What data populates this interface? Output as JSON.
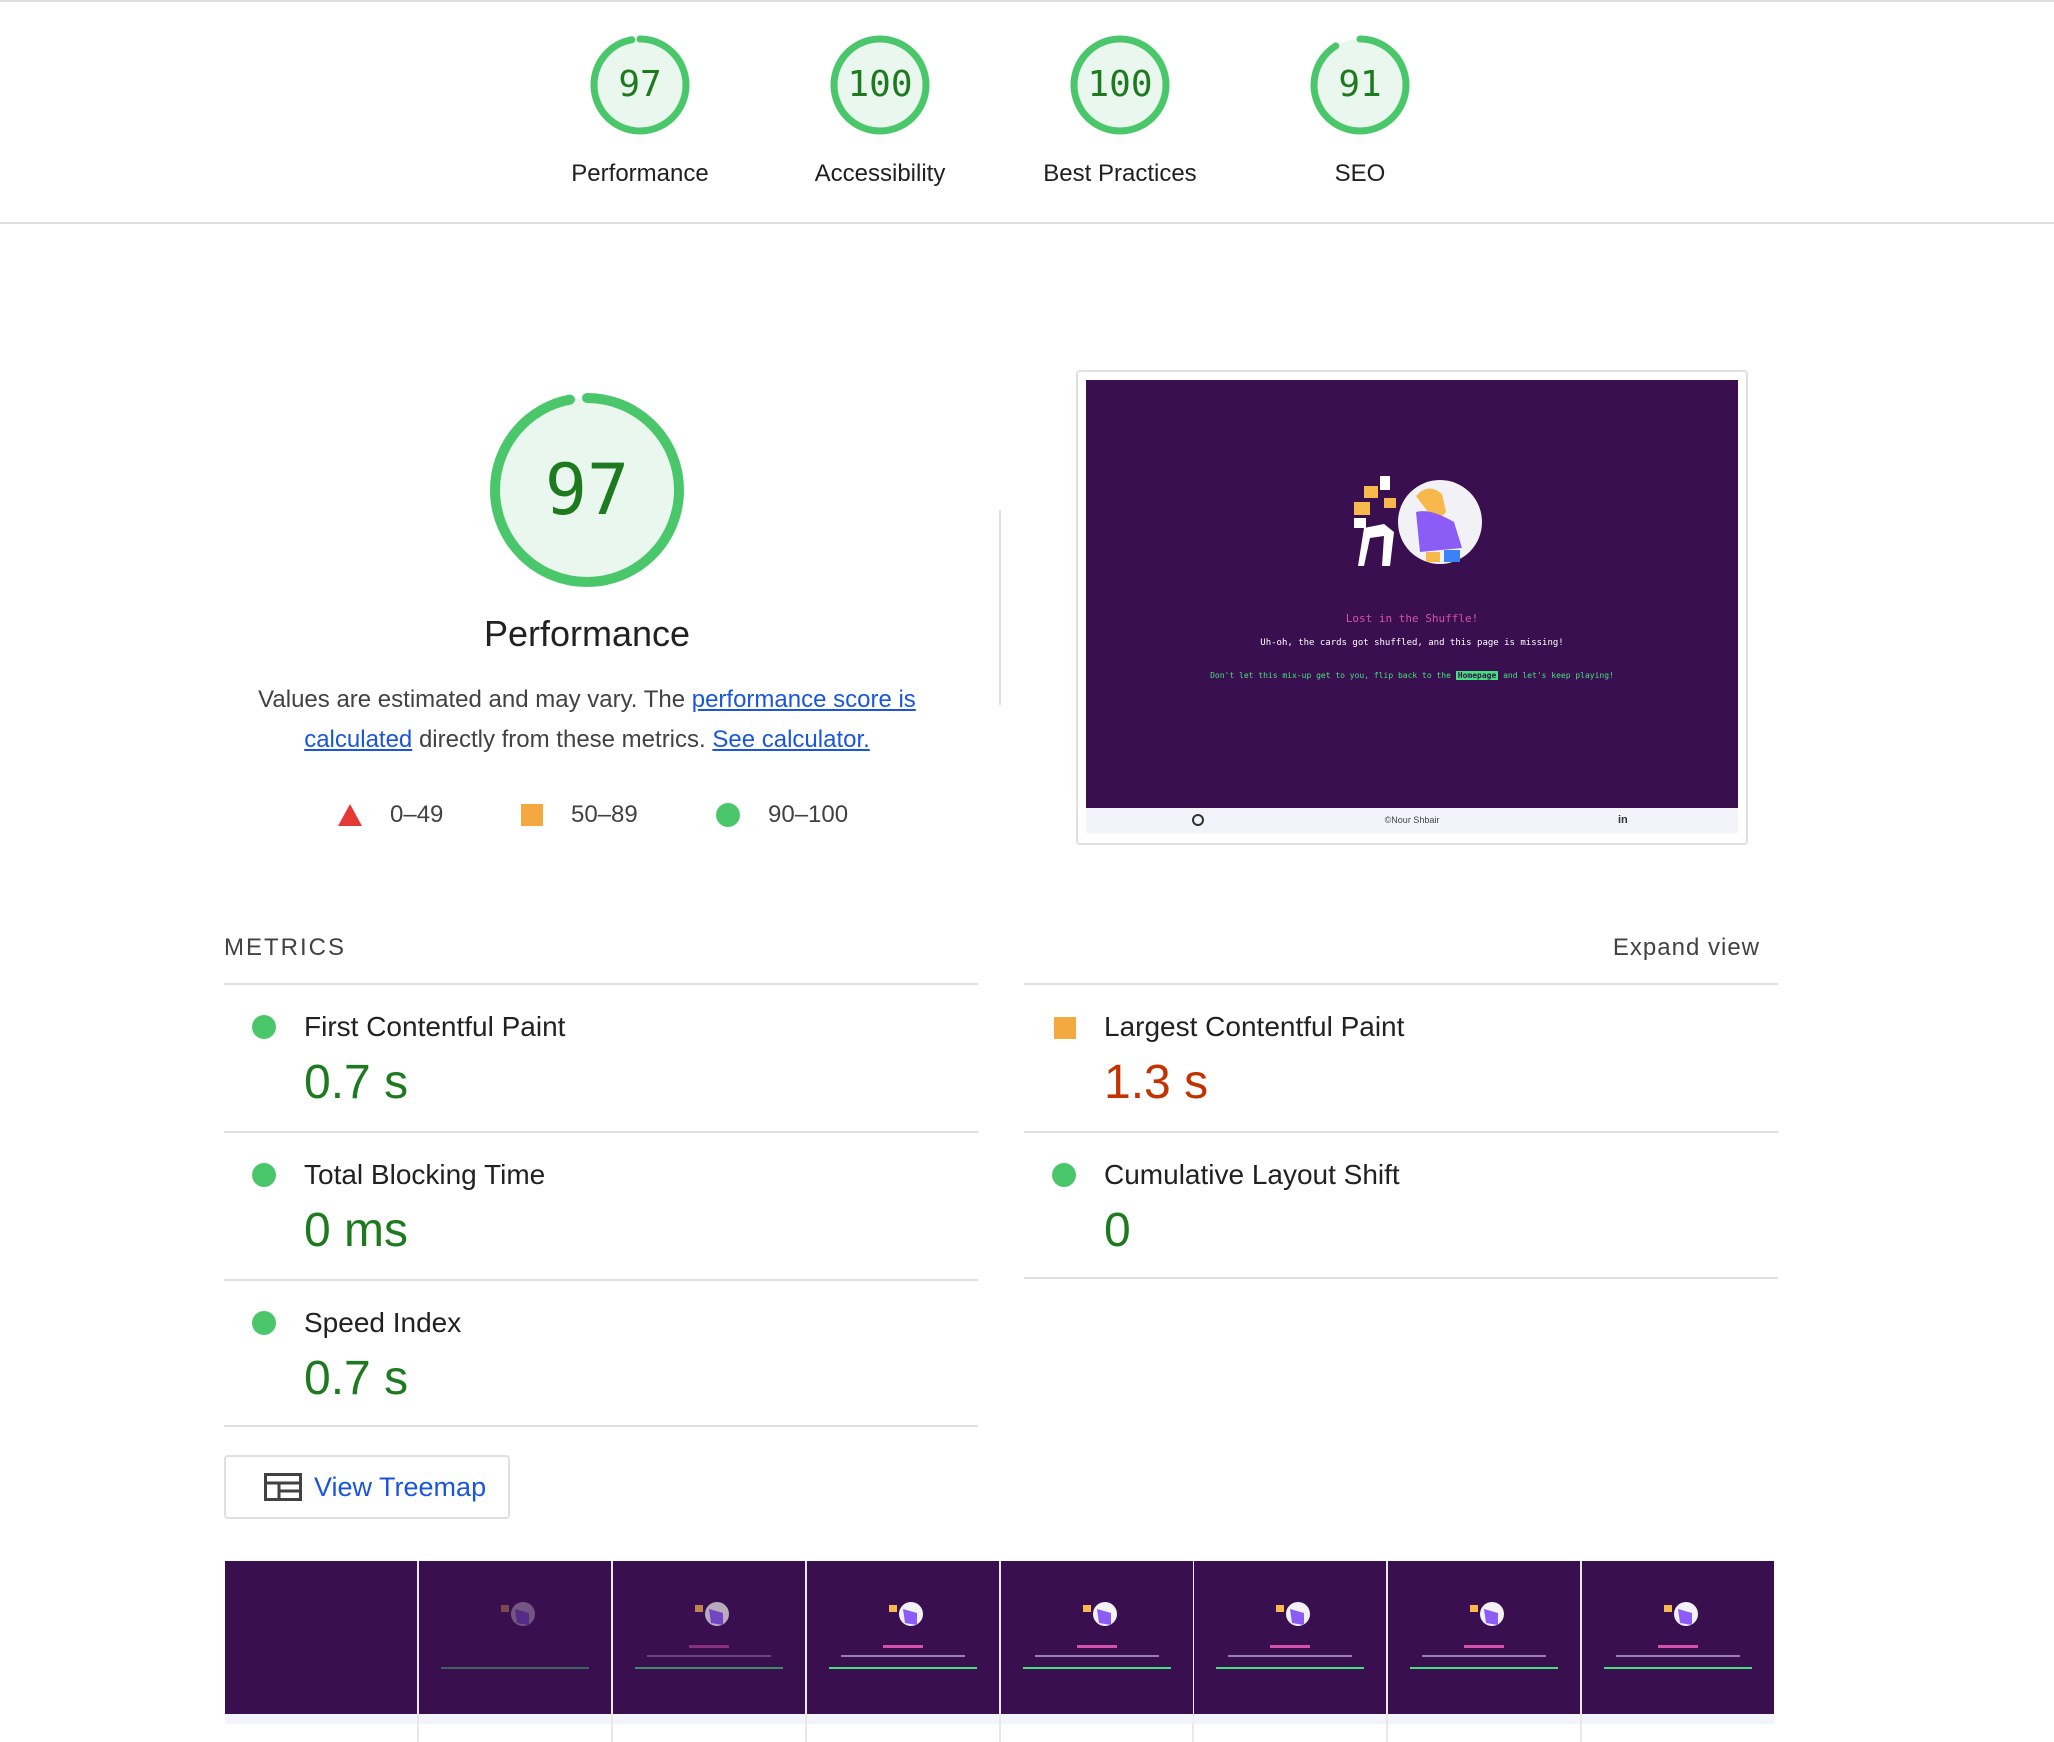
{
  "scores": [
    {
      "value": "97",
      "label": "Performance",
      "fraction": 0.97
    },
    {
      "value": "100",
      "label": "Accessibility",
      "fraction": 1.0
    },
    {
      "value": "100",
      "label": "Best Practices",
      "fraction": 1.0
    },
    {
      "value": "91",
      "label": "SEO",
      "fraction": 0.91
    }
  ],
  "hero": {
    "value": "97",
    "fraction": 0.97,
    "title": "Performance",
    "desc_prefix": "Values are estimated and may vary. The ",
    "desc_link1": "performance score is calculated",
    "desc_middle": " directly from these metrics. ",
    "desc_link2": "See calculator."
  },
  "legend": [
    {
      "shape": "triangle",
      "range": "0–49",
      "color": "#e53935"
    },
    {
      "shape": "square",
      "range": "50–89",
      "color": "#f4a940"
    },
    {
      "shape": "circle",
      "range": "90–100",
      "color": "#4ac76b"
    }
  ],
  "preview": {
    "title": "Lost in the Shuffle!",
    "subtitle": "Uh-oh, the cards got shuffled, and this page is missing!",
    "line_prefix": "Don't let this mix-up get to you, flip back to the ",
    "line_link": "Homepage",
    "line_suffix": " and let's keep playing!",
    "footer_center": "©Nour Shbair",
    "footer_right": "in",
    "footer_left_icon": "github-icon",
    "background_color": "#3a0f4f"
  },
  "metrics": {
    "heading": "METRICS",
    "expand_label": "Expand view",
    "items": [
      {
        "name": "First Contentful Paint",
        "value": "0.7 s",
        "rating": "pass"
      },
      {
        "name": "Largest Contentful Paint",
        "value": "1.3 s",
        "rating": "average"
      },
      {
        "name": "Total Blocking Time",
        "value": "0 ms",
        "rating": "pass"
      },
      {
        "name": "Cumulative Layout Shift",
        "value": "0",
        "rating": "pass"
      },
      {
        "name": "Speed Index",
        "value": "0.7 s",
        "rating": "pass"
      }
    ]
  },
  "treemap": {
    "label": "View Treemap",
    "icon": "treemap-icon"
  },
  "colors": {
    "pass": "#1e7a1e",
    "average": "#c33300",
    "gauge_ring": "#4ac76b",
    "gauge_fill": "#eaf7ee",
    "link": "#1a56db"
  }
}
